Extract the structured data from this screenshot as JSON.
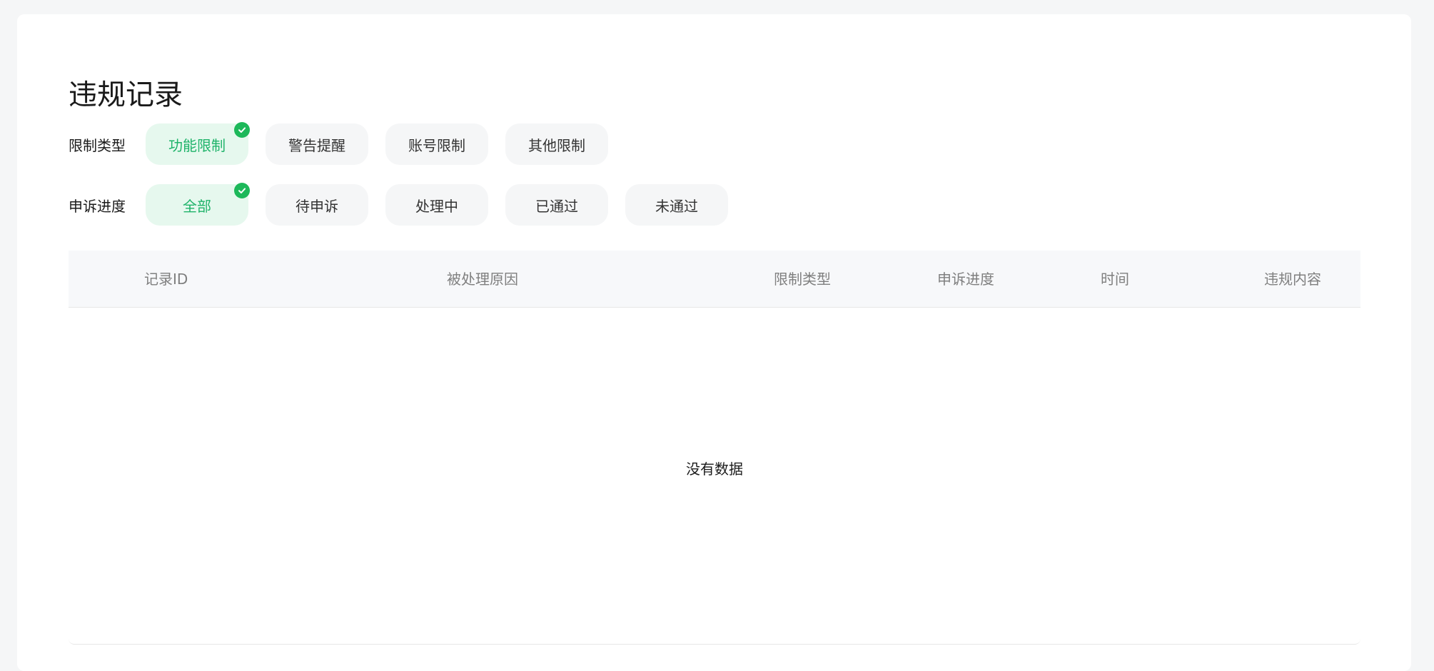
{
  "page": {
    "title": "违规记录"
  },
  "filters": {
    "restriction_type": {
      "label": "限制类型",
      "options": [
        "功能限制",
        "警告提醒",
        "账号限制",
        "其他限制"
      ],
      "selected": "功能限制"
    },
    "appeal_progress": {
      "label": "申诉进度",
      "options": [
        "全部",
        "待申诉",
        "处理中",
        "已通过",
        "未通过"
      ],
      "selected": "全部"
    }
  },
  "table": {
    "columns": [
      "记录ID",
      "被处理原因",
      "限制类型",
      "申诉进度",
      "时间",
      "违规内容"
    ],
    "empty_text": "没有数据"
  },
  "colors": {
    "accent": "#1fb36a",
    "chip_active_bg": "#e6f8ee",
    "chip_bg": "#f5f6f7",
    "check": "#1db85a"
  },
  "icons": {
    "selected_indicator": "check-circle-icon"
  }
}
